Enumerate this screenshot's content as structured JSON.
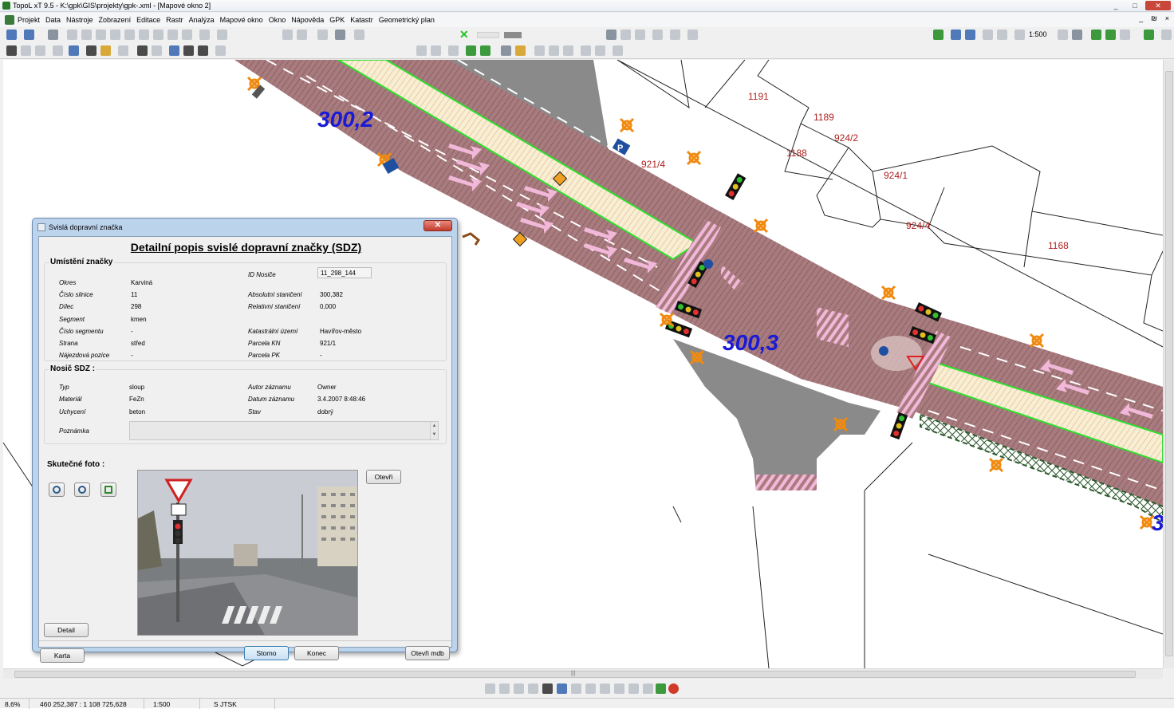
{
  "window": {
    "title": "TopoL xT 9.5 - K:\\gpk\\GIS\\projekty\\gpk-.xml - [Mapové okno 2]",
    "controls": [
      "_",
      "□",
      "✕"
    ],
    "mdi_controls": [
      "_",
      "₪",
      "×"
    ]
  },
  "menu": [
    "Projekt",
    "Data",
    "Nástroje",
    "Zobrazení",
    "Editace",
    "Rastr",
    "Analýza",
    "Mapové okno",
    "Okno",
    "Nápověda",
    "GPK",
    "Katastr",
    "Geometrický plan"
  ],
  "toolbar": {
    "scale": "1:500"
  },
  "map": {
    "station_labels": [
      "300,2",
      "300,3",
      "3"
    ],
    "parcels": [
      "1191",
      "1189",
      "924/2",
      "1188",
      "921/4",
      "924/1",
      "924/4",
      "1168"
    ],
    "colors": {
      "road": "#a0777a",
      "road_hatch": "#8a5a5c",
      "median": "#f6ecc8",
      "median_border": "#2ee02e",
      "asphalt": "#888888",
      "arrow": "#f0b8e0",
      "station_text": "#1a1ad6",
      "parcel_text": "#b02020",
      "signal_orange": "#f08a10"
    }
  },
  "dialog": {
    "title": "Svislá dopravní značka",
    "close_label": "✕",
    "heading": "Detailní popis svislé dopravní značky (SDZ)",
    "location": {
      "title": "Umístění značky",
      "id_label": "ID Nosiče",
      "id_value": "11_298_144",
      "left": [
        {
          "label": "Okres",
          "value": "Karviná"
        },
        {
          "label": "Číslo silnice",
          "value": "11"
        },
        {
          "label": "Dílec",
          "value": "298"
        },
        {
          "label": "Segment",
          "value": "kmen"
        },
        {
          "label": "Číslo segmentu",
          "value": "-"
        },
        {
          "label": "Strana",
          "value": "střed"
        },
        {
          "label": "Nájezdová pozice",
          "value": "-"
        }
      ],
      "right": [
        {
          "label": "Absolutní staničení",
          "value": "300,382"
        },
        {
          "label": "Relativní staničení",
          "value": "0,000"
        },
        {
          "label": "Katastrální území",
          "value": "Havířov-město"
        },
        {
          "label": "Parcela KN",
          "value": "921/1"
        },
        {
          "label": "Parcela PK",
          "value": "-"
        }
      ]
    },
    "carrier": {
      "title": "Nosič SDZ :",
      "left": [
        {
          "label": "Typ",
          "value": "sloup"
        },
        {
          "label": "Materiál",
          "value": "FeZn"
        },
        {
          "label": "Uchycení",
          "value": "beton"
        }
      ],
      "right": [
        {
          "label": "Autor záznamu",
          "value": "Owner"
        },
        {
          "label": "Datum záznamu",
          "value": "3.4.2007 8:48:46"
        },
        {
          "label": "Stav",
          "value": "dobrý"
        }
      ],
      "note_label": "Poznámka",
      "note_value": ""
    },
    "photo_label": "Skutečné foto :",
    "buttons": {
      "open": "Otevři",
      "detail": "Detail",
      "map": "Karta",
      "cancel": "Storno",
      "end": "Konec",
      "open_mdb": "Otevři mdb"
    }
  },
  "status": {
    "zoom": "8,6%",
    "coords": "460 252,387 : 1 108 725,628",
    "scale": "1:500",
    "crs": "S JTSK"
  }
}
